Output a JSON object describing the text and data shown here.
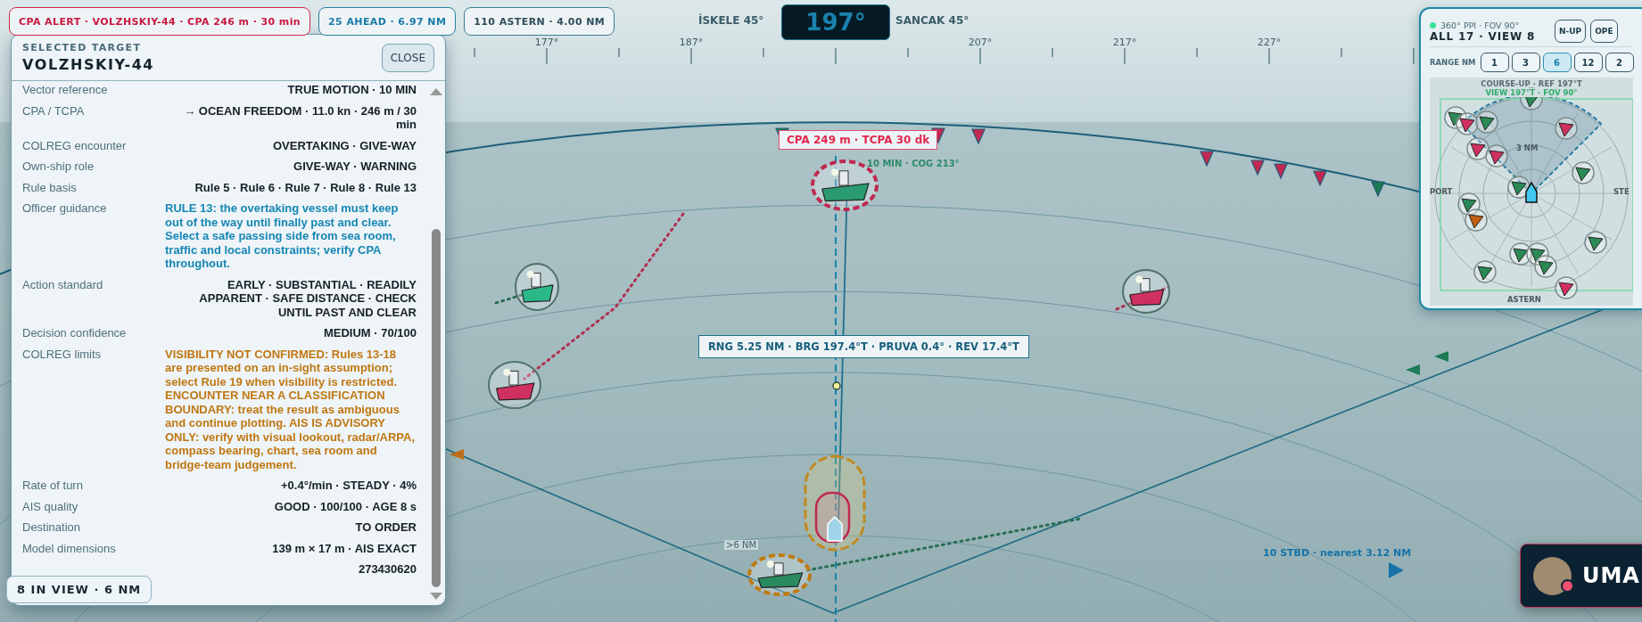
{
  "alerts": [
    {
      "text": "CPA ALERT · VOLZHSKIY-44 · CPA 246 m · 30 min",
      "kind": "alarm"
    },
    {
      "text": "25 AHEAD · 6.97 NM",
      "kind": "info"
    },
    {
      "text": "110 ASTERN · 4.00 NM",
      "kind": "neutral"
    }
  ],
  "heading": {
    "value": "197°",
    "port_label": "İSKELE 45°",
    "starboard_label": "SANCAK 45°"
  },
  "compass_ticks": [
    "177°",
    "187°",
    "207°",
    "217°",
    "227°"
  ],
  "target_panel": {
    "caption": "SELECTED TARGET",
    "name": "VOLZHSKIY-44",
    "close_label": "CLOSE",
    "rows": [
      {
        "label": "Vector reference",
        "value": "TRUE MOTION · 10 MIN",
        "kind": "plain"
      },
      {
        "label": "CPA / TCPA",
        "value": "→ OCEAN FREEDOM · 11.0 kn · 246 m / 30 min",
        "kind": "plain"
      },
      {
        "label": "COLREG encounter",
        "value": "OVERTAKING · GIVE-WAY",
        "kind": "plain"
      },
      {
        "label": "Own-ship role",
        "value": "GIVE-WAY · WARNING",
        "kind": "plain"
      },
      {
        "label": "Rule basis",
        "value": "Rule 5 · Rule 6 · Rule 7 · Rule 8 · Rule 13",
        "kind": "plain"
      },
      {
        "label": "Officer guidance",
        "value": "RULE 13: the overtaking vessel must keep out of the way until finally past and clear. Select a safe passing side from sea room, traffic and local constraints; verify CPA throughout.",
        "kind": "guidance"
      },
      {
        "label": "Action standard",
        "value": "EARLY · SUBSTANTIAL · READILY APPARENT · SAFE DISTANCE · CHECK UNTIL PAST AND CLEAR",
        "kind": "plain"
      },
      {
        "label": "Decision confidence",
        "value": "MEDIUM · 70/100",
        "kind": "plain"
      },
      {
        "label": "COLREG limits",
        "value": "VISIBILITY NOT CONFIRMED: Rules 13-18 are presented on an in-sight assumption; select Rule 19 when visibility is restricted. ENCOUNTER NEAR A CLASSIFICATION BOUNDARY: treat the result as ambiguous and continue plotting. AIS IS ADVISORY ONLY: verify with visual lookout, radar/ARPA, compass bearing, chart, sea room and bridge-team judgement.",
        "kind": "caution"
      },
      {
        "label": "Rate of turn",
        "value": "+0.4°/min · STEADY · 4%",
        "kind": "plain"
      },
      {
        "label": "AIS quality",
        "value": "GOOD · 100/100 · AGE 8 s",
        "kind": "plain"
      },
      {
        "label": "Destination",
        "value": "TO ORDER",
        "kind": "plain"
      },
      {
        "label": "Model dimensions",
        "value": "139 m × 17 m · AIS EXACT",
        "kind": "plain"
      },
      {
        "value": "273430620",
        "kind": "plain"
      }
    ]
  },
  "view_badge": "8 IN VIEW · 6 NM",
  "map_labels": {
    "cpa_tag": "CPA 249 m · TCPA 30 dk",
    "vector_label": "10 MIN · COG 213°",
    "bearing_tag": "RNG 5.25 NM · BRG 197.4°T · PRUVA 0.4° · REV 17.4°T",
    "range_note": ">6 NM",
    "starboard_count": "10 STBD · nearest 3.12 NM"
  },
  "mini_radar": {
    "status": "360° PPI · FOV 90°",
    "counts": "ALL 17 · VIEW 8",
    "buttons": [
      "N-UP",
      "OPE"
    ],
    "range_label": "RANGE NM",
    "ranges": [
      {
        "label": "1",
        "selected": false
      },
      {
        "label": "3",
        "selected": false
      },
      {
        "label": "6",
        "selected": true
      },
      {
        "label": "12",
        "selected": false
      },
      {
        "label": "2",
        "selected": false
      }
    ],
    "reference": "COURSE-UP · REF 197°T",
    "view": "VIEW 197°T · FOV 90°",
    "ring_label": "3 NM",
    "port": "PORT",
    "starboard": "STE",
    "astern": "ASTERN"
  },
  "user": {
    "name": "UMA"
  }
}
